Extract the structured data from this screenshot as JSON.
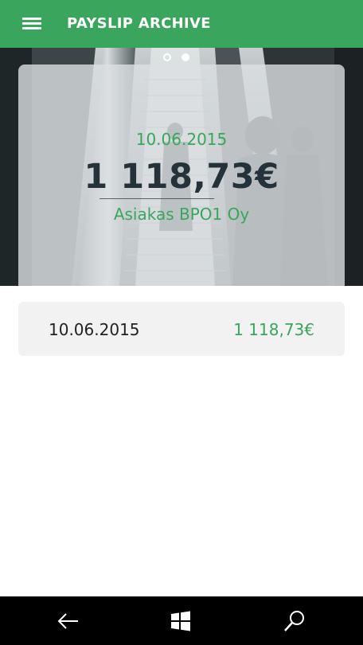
{
  "header": {
    "title": "PAYSLIP ARCHIVE",
    "menu_icon": "hamburger-menu-icon"
  },
  "hero": {
    "carousel_page_count": 2,
    "carousel_active_index": 1,
    "card": {
      "date": "10.06.2015",
      "amount": "1 118,73€",
      "company": "Asiakas BPO1 Oy"
    }
  },
  "payslips": [
    {
      "date": "10.06.2015",
      "amount": "1 118,73€"
    }
  ],
  "navbar": {
    "back_icon": "back-arrow-icon",
    "home_icon": "windows-logo-icon",
    "search_icon": "search-icon"
  },
  "colors": {
    "accent": "#3aa55d",
    "amount_dark": "#24323a",
    "nav_bg": "#000000"
  }
}
